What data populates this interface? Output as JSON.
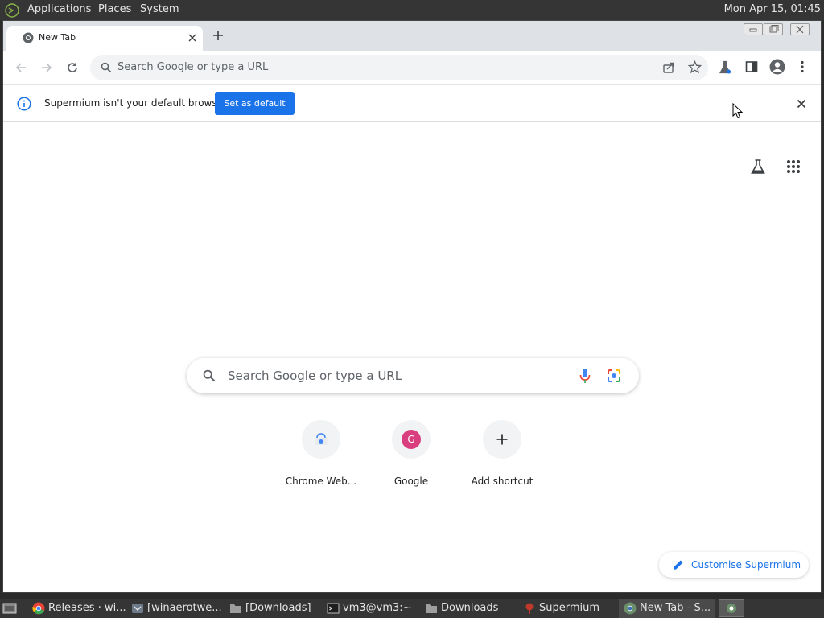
{
  "top_panel": {
    "menus": [
      "Applications",
      "Places",
      "System"
    ],
    "clock": "Mon Apr 15, 01:45"
  },
  "browser": {
    "tab": {
      "title": "New Tab"
    },
    "omnibox": {
      "placeholder": "Search Google or type a URL"
    },
    "infobar": {
      "message": "Supermium isn't your default browser",
      "button": "Set as default"
    },
    "ntp": {
      "search_placeholder": "Search Google or type a URL",
      "shortcuts": [
        {
          "label": "Chrome Web...",
          "icon": "chrome-web-store-icon"
        },
        {
          "label": "Google",
          "icon": "google-letter-icon",
          "letter": "G"
        },
        {
          "label": "Add shortcut",
          "icon": "plus-icon"
        }
      ],
      "customise_label": "Customise Supermium"
    }
  },
  "taskbar": {
    "items": [
      {
        "label": "Releases · wi...",
        "icon": "chrome-icon",
        "active": false
      },
      {
        "label": "[winaerotwe...",
        "icon": "app-icon",
        "active": false
      },
      {
        "label": "[Downloads]",
        "icon": "folder-icon",
        "active": false
      },
      {
        "label": "vm3@vm3:~",
        "icon": "terminal-icon",
        "active": false
      },
      {
        "label": "Downloads",
        "icon": "folder-icon",
        "active": false
      },
      {
        "label": "Supermium",
        "icon": "supermium-icon",
        "active": false
      },
      {
        "label": "New Tab - S...",
        "icon": "chrome-icon",
        "active": true
      }
    ]
  },
  "colors": {
    "accent": "#1a73e8",
    "panel": "#353535",
    "tabstrip": "#dee1e6",
    "google_letter_bg": "#d93f7e"
  }
}
